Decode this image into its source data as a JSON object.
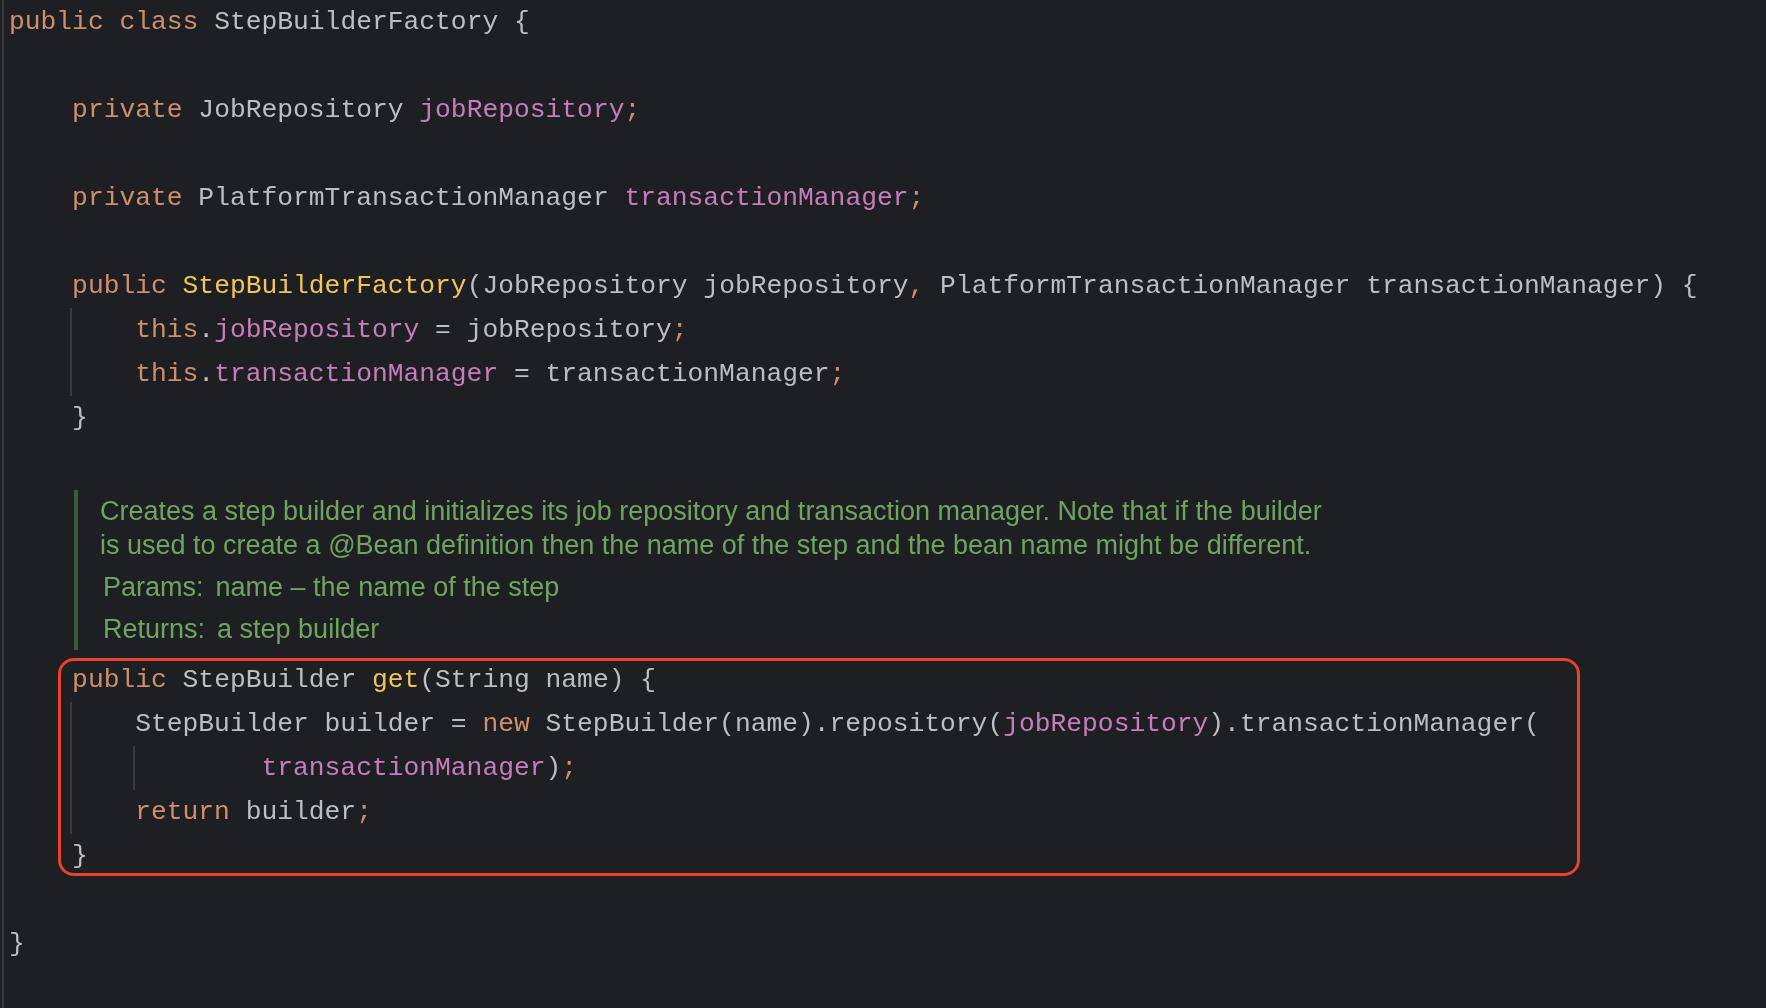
{
  "code_before": [
    {
      "kind": "code",
      "tokens": [
        {
          "kind": "kw",
          "text": "public class "
        },
        {
          "kind": "plain",
          "text": "StepBuilderFactory {"
        }
      ]
    },
    {
      "kind": "blank"
    },
    {
      "kind": "code",
      "tokens": [
        {
          "kind": "indent"
        },
        {
          "kind": "kw",
          "text": "private "
        },
        {
          "kind": "plain",
          "text": "JobRepository "
        },
        {
          "kind": "field",
          "text": "jobRepository"
        },
        {
          "kind": "punct",
          "text": ";"
        }
      ]
    },
    {
      "kind": "blank"
    },
    {
      "kind": "code",
      "tokens": [
        {
          "kind": "indent"
        },
        {
          "kind": "kw",
          "text": "private "
        },
        {
          "kind": "plain",
          "text": "PlatformTransactionManager "
        },
        {
          "kind": "field",
          "text": "transactionManager"
        },
        {
          "kind": "punct",
          "text": ";"
        }
      ]
    },
    {
      "kind": "blank"
    },
    {
      "kind": "code",
      "tokens": [
        {
          "kind": "indent"
        },
        {
          "kind": "kw",
          "text": "public "
        },
        {
          "kind": "method",
          "text": "StepBuilderFactory"
        },
        {
          "kind": "plain",
          "text": "(JobRepository jobRepository"
        },
        {
          "kind": "punct",
          "text": ", "
        },
        {
          "kind": "plain",
          "text": "PlatformTransactionManager transactionManager) {"
        }
      ]
    },
    {
      "kind": "code",
      "tokens": [
        {
          "kind": "indent"
        },
        {
          "kind": "guide"
        },
        {
          "kind": "kw",
          "text": "this"
        },
        {
          "kind": "plain",
          "text": "."
        },
        {
          "kind": "field",
          "text": "jobRepository"
        },
        {
          "kind": "plain",
          "text": " = jobRepository"
        },
        {
          "kind": "punct",
          "text": ";"
        }
      ]
    },
    {
      "kind": "code",
      "tokens": [
        {
          "kind": "indent"
        },
        {
          "kind": "guide"
        },
        {
          "kind": "kw",
          "text": "this"
        },
        {
          "kind": "plain",
          "text": "."
        },
        {
          "kind": "field",
          "text": "transactionManager"
        },
        {
          "kind": "plain",
          "text": " = transactionManager"
        },
        {
          "kind": "punct",
          "text": ";"
        }
      ]
    },
    {
      "kind": "code",
      "tokens": [
        {
          "kind": "indent"
        },
        {
          "kind": "plain",
          "text": "}"
        }
      ]
    },
    {
      "kind": "blank"
    }
  ],
  "doc_comment": {
    "description": "Creates a step builder and initializes its job repository and transaction manager. Note that if the builder is used to create a @Bean definition then the name of the step and the bean name might be different.",
    "tags": [
      {
        "label": "Params:",
        "text": "name – the name of the step"
      },
      {
        "label": "Returns:",
        "text": "a step builder"
      }
    ]
  },
  "highlighted_code": [
    {
      "kind": "code",
      "tokens": [
        {
          "kind": "indent"
        },
        {
          "kind": "kw",
          "text": "public "
        },
        {
          "kind": "plain",
          "text": "StepBuilder "
        },
        {
          "kind": "method",
          "text": "get"
        },
        {
          "kind": "plain",
          "text": "(String name) {"
        }
      ]
    },
    {
      "kind": "code",
      "tokens": [
        {
          "kind": "indent"
        },
        {
          "kind": "guide"
        },
        {
          "kind": "plain",
          "text": "StepBuilder builder = "
        },
        {
          "kind": "kw",
          "text": "new "
        },
        {
          "kind": "plain",
          "text": "StepBuilder(name).repository("
        },
        {
          "kind": "field",
          "text": "jobRepository"
        },
        {
          "kind": "plain",
          "text": ").transactionManager("
        }
      ]
    },
    {
      "kind": "code",
      "tokens": [
        {
          "kind": "indent"
        },
        {
          "kind": "guide"
        },
        {
          "kind": "guide_wide"
        },
        {
          "kind": "field",
          "text": "transactionManager"
        },
        {
          "kind": "plain",
          "text": ")"
        },
        {
          "kind": "punct",
          "text": ";"
        }
      ]
    },
    {
      "kind": "code",
      "tokens": [
        {
          "kind": "indent"
        },
        {
          "kind": "guide"
        },
        {
          "kind": "kw",
          "text": "return "
        },
        {
          "kind": "plain",
          "text": "builder"
        },
        {
          "kind": "punct",
          "text": ";"
        }
      ]
    },
    {
      "kind": "code",
      "tokens": [
        {
          "kind": "indent"
        },
        {
          "kind": "plain",
          "text": "}"
        }
      ]
    }
  ],
  "code_after": [
    {
      "kind": "blank"
    },
    {
      "kind": "code",
      "tokens": [
        {
          "kind": "plain",
          "text": "}"
        }
      ]
    }
  ]
}
